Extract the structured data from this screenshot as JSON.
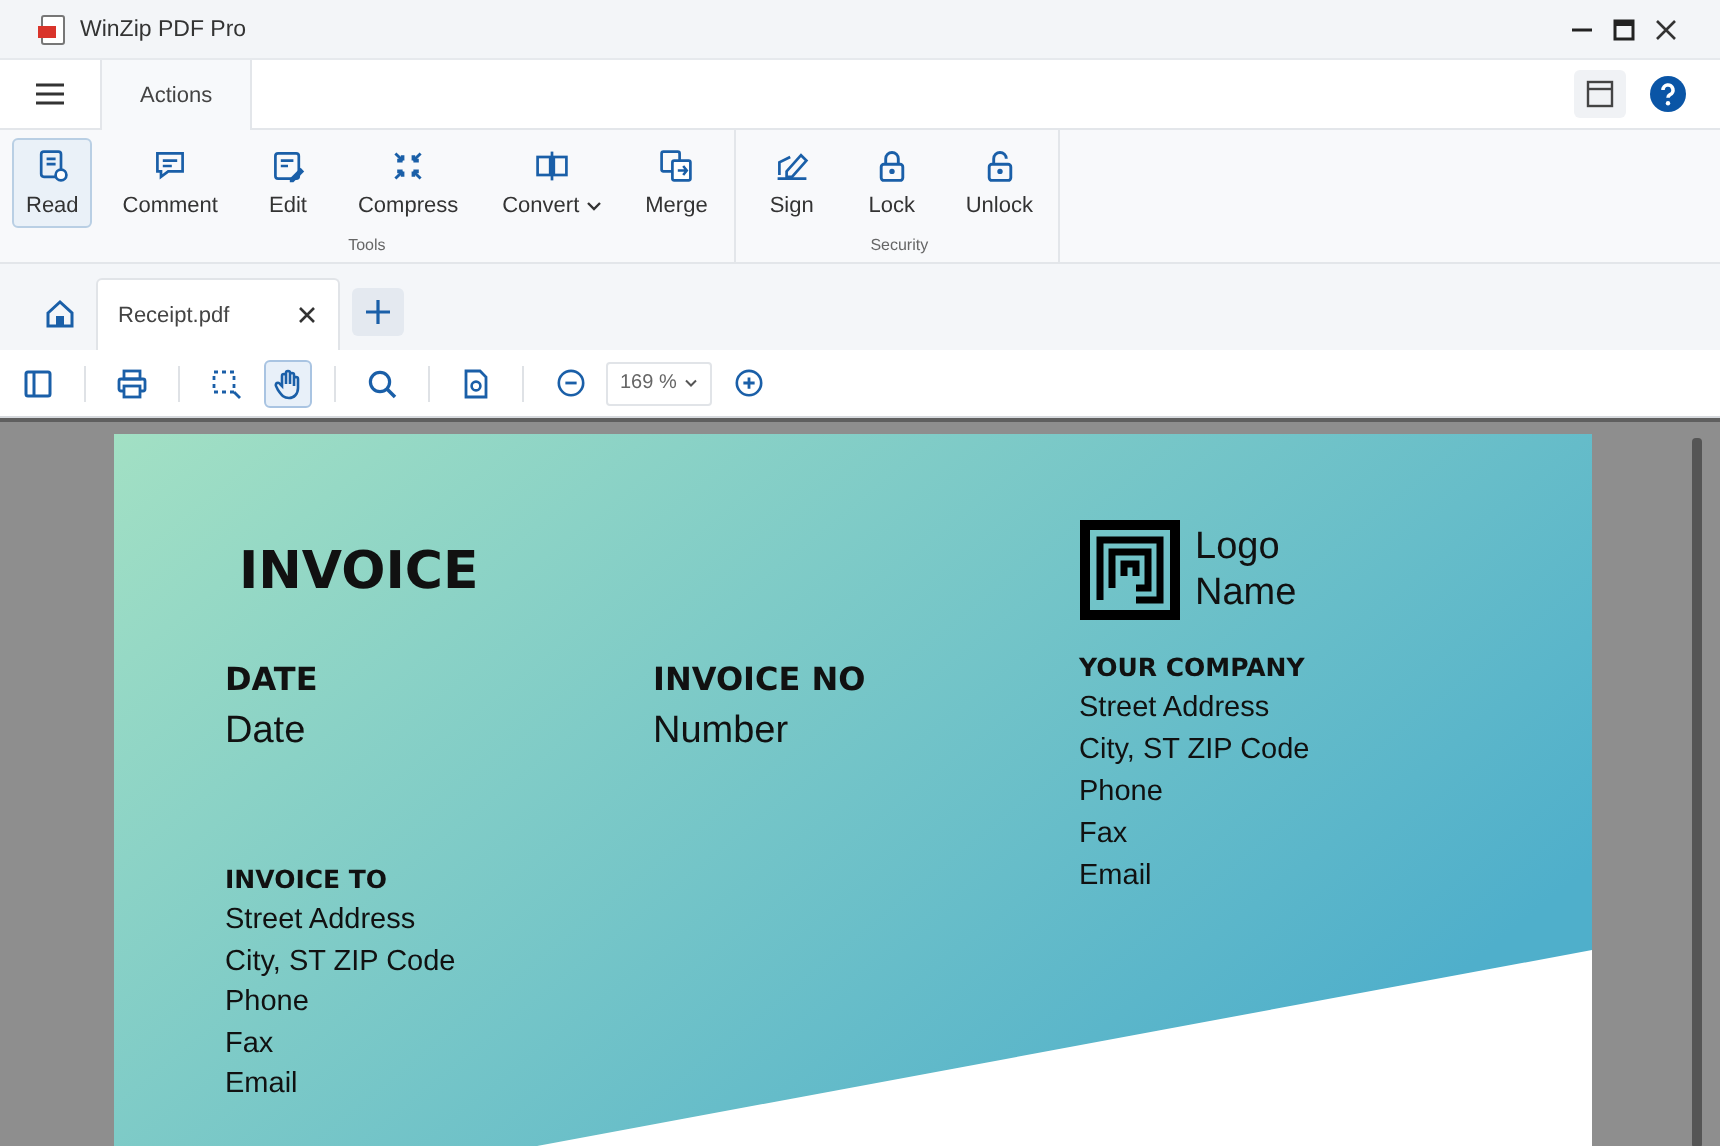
{
  "window": {
    "title": "WinZip PDF Pro"
  },
  "ribbon_tab": {
    "label": "Actions",
    "selected": true
  },
  "ribbon_groups": [
    {
      "label": "Tools",
      "buttons": [
        {
          "label": "Read",
          "selected": true,
          "dropdown": false
        },
        {
          "label": "Comment",
          "selected": false,
          "dropdown": false
        },
        {
          "label": "Edit",
          "selected": false,
          "dropdown": false
        },
        {
          "label": "Compress",
          "selected": false,
          "dropdown": false
        },
        {
          "label": "Convert",
          "selected": false,
          "dropdown": true
        },
        {
          "label": "Merge",
          "selected": false,
          "dropdown": false
        }
      ]
    },
    {
      "label": "Security",
      "buttons": [
        {
          "label": "Sign",
          "selected": false,
          "dropdown": false
        },
        {
          "label": "Lock",
          "selected": false,
          "dropdown": false
        },
        {
          "label": "Unlock",
          "selected": false,
          "dropdown": false
        }
      ]
    }
  ],
  "document_tabs": [
    {
      "label": "Receipt.pdf",
      "selected": true
    }
  ],
  "toolbar": {
    "tools": [
      {
        "kind": "sidebar",
        "selected": false
      },
      {
        "kind": "print",
        "selected": false
      },
      {
        "kind": "select",
        "selected": false
      },
      {
        "kind": "hand",
        "selected": true
      },
      {
        "kind": "search",
        "selected": false
      },
      {
        "kind": "page",
        "selected": false
      }
    ],
    "zoom": "169 %"
  },
  "document": {
    "title": "INVOICE",
    "logo": [
      "Logo",
      "Name"
    ],
    "date": {
      "heading": "DATE",
      "value": "Date"
    },
    "invoice_no": {
      "heading": "INVOICE NO",
      "value": "Number"
    },
    "company": {
      "heading": "YOUR COMPANY",
      "lines": [
        "Street Address",
        "City, ST ZIP Code",
        "Phone",
        "Fax",
        "Email"
      ]
    },
    "invoice_to": {
      "heading": "INVOICE TO",
      "lines": [
        "Street Address",
        "City, ST ZIP Code",
        "Phone",
        "Fax",
        "Email"
      ]
    }
  }
}
